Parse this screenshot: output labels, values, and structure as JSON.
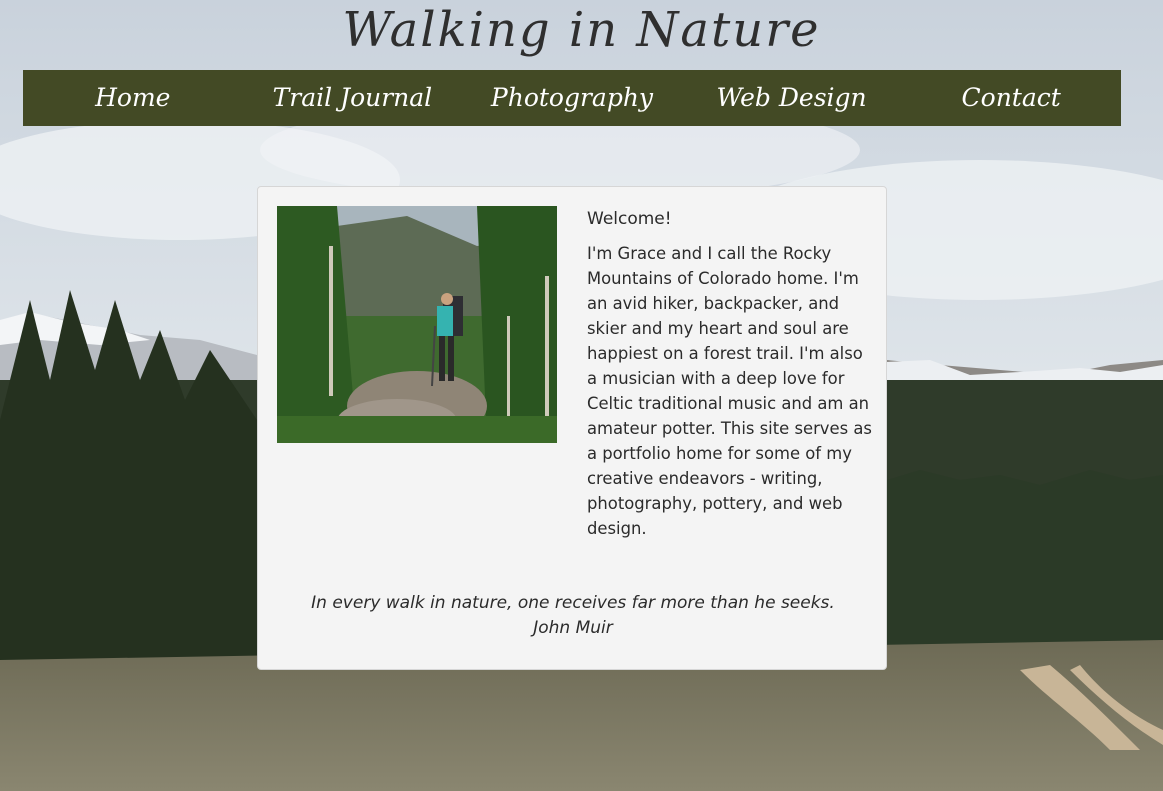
{
  "header": {
    "site_title": "Walking in Nature"
  },
  "nav": {
    "items": [
      {
        "label": "Home"
      },
      {
        "label": "Trail Journal"
      },
      {
        "label": "Photography"
      },
      {
        "label": "Web Design"
      },
      {
        "label": "Contact"
      }
    ]
  },
  "main": {
    "welcome": "Welcome!",
    "intro": "I'm Grace and I call the Rocky Mountains of Colorado home. I'm an avid hiker, backpacker, and skier and my heart and soul are happiest on a forest trail. I'm also a musician with a deep love for Celtic traditional music and am an amateur potter. This site serves as a portfolio home for some of my creative endeavors - writing, photography, pottery, and web design.",
    "quote": {
      "text": "In every walk in nature, one receives far more than he seeks.",
      "author": "John Muir"
    }
  },
  "colors": {
    "nav_background": "#434a25",
    "card_background": "#f4f4f4",
    "text": "#2b2b2b"
  }
}
